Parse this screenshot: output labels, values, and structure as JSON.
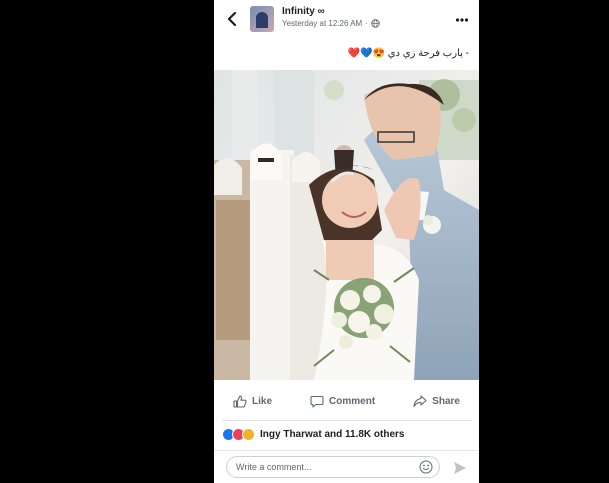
{
  "post": {
    "author": "Infinity ∞",
    "timestamp": "Yesterday at 12:26 AM",
    "separator": "·",
    "caption": "- يارب فرحة زي دي 😍💙❤️",
    "photo_icon": "wedding-photo"
  },
  "actions": {
    "like_label": "Like",
    "comment_label": "Comment",
    "share_label": "Share"
  },
  "reactions": {
    "summary": "Ingy Tharwat and 11.8K others",
    "types": [
      "like",
      "love",
      "wow"
    ],
    "colors": {
      "like": "#1877f2",
      "love": "#f33e58",
      "wow": "#f7b125"
    }
  },
  "composer": {
    "placeholder": "Write a comment..."
  },
  "icons": {
    "back": "chevron-left-icon",
    "more": "more-horizontal-icon",
    "globe": "globe-icon",
    "emoji": "emoji-icon",
    "send": "send-icon"
  }
}
